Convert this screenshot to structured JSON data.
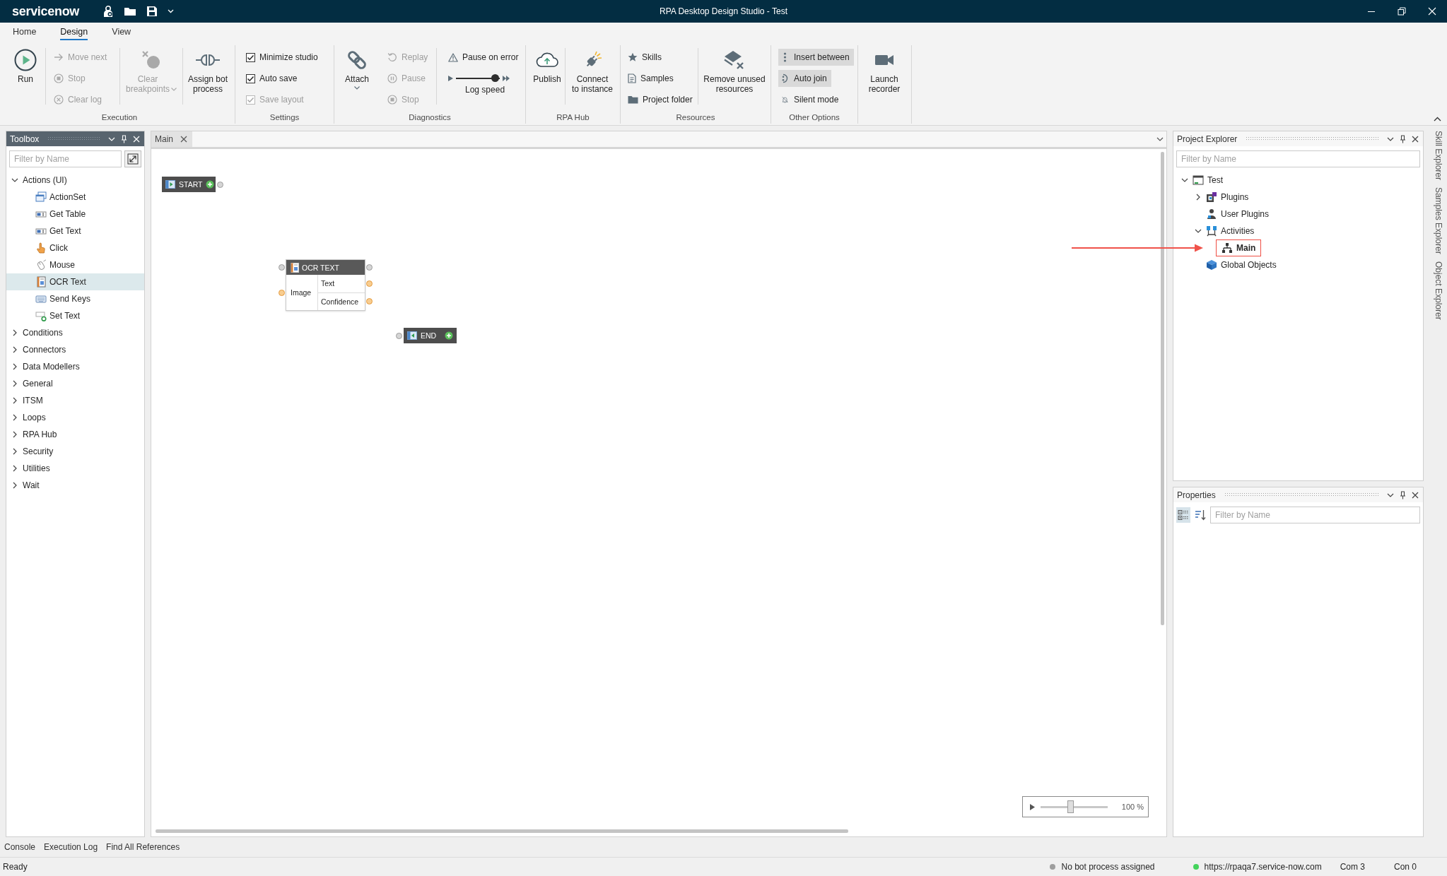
{
  "title_bar": {
    "logo": "servicenow",
    "title": "RPA Desktop Design Studio - Test"
  },
  "ribbon_tabs": [
    {
      "label": "Home",
      "selected": false
    },
    {
      "label": "Design",
      "selected": true
    },
    {
      "label": "View",
      "selected": false
    }
  ],
  "ribbon": {
    "execution": {
      "label": "Execution",
      "run": {
        "label": "Run",
        "disabled": false
      },
      "move_next": {
        "label": "Move next",
        "disabled": true
      },
      "stop": {
        "label": "Stop",
        "disabled": true
      },
      "clear_log": {
        "label": "Clear log",
        "disabled": true
      },
      "clear_breakpoints": {
        "label": "Clear\nbreakpoints",
        "disabled": true
      },
      "assign_bot_process": {
        "label": "Assign bot\nprocess",
        "disabled": false
      }
    },
    "settings": {
      "label": "Settings",
      "options": [
        {
          "label": "Minimize studio",
          "checked": true,
          "disabled": false
        },
        {
          "label": "Auto save",
          "checked": true,
          "disabled": false
        },
        {
          "label": "Save layout",
          "checked": true,
          "disabled": true
        }
      ]
    },
    "diagnostics": {
      "label": "Diagnostics",
      "attach": {
        "label": "Attach",
        "disabled": false
      },
      "replay": {
        "label": "Replay",
        "disabled": true
      },
      "pause": {
        "label": "Pause",
        "disabled": true
      },
      "stop": {
        "label": "Stop",
        "disabled": true
      },
      "pause_on_error": {
        "label": "Pause on error",
        "on": false
      },
      "log_speed": {
        "label": "Log speed",
        "level": 0.9
      }
    },
    "rpa_hub": {
      "label": "RPA Hub",
      "publish": {
        "label": "Publish"
      },
      "connect": {
        "label": "Connect\nto instance"
      }
    },
    "resources": {
      "label": "Resources",
      "skills": {
        "label": "Skills"
      },
      "samples": {
        "label": "Samples"
      },
      "project_folder": {
        "label": "Project folder"
      },
      "remove_unused": {
        "label": "Remove unused\nresources"
      }
    },
    "other_options": {
      "label": "Other Options",
      "toggles": [
        {
          "label": "Insert between",
          "on": true
        },
        {
          "label": "Auto join",
          "on": true
        },
        {
          "label": "Silent mode",
          "on": false
        }
      ]
    },
    "recorder": {
      "launch_recorder": {
        "label": "Launch\nrecorder"
      }
    }
  },
  "toolbox": {
    "title": "Toolbox",
    "active": true,
    "filter": {
      "placeholder": "Filter by Name"
    },
    "tree": [
      {
        "label": "Actions (UI)",
        "expanded": true,
        "selected": false,
        "children": [
          {
            "label": "ActionSet",
            "selected": false
          },
          {
            "label": "Get Table",
            "selected": false
          },
          {
            "label": "Get Text",
            "selected": false
          },
          {
            "label": "Click",
            "selected": false
          },
          {
            "label": "Mouse",
            "selected": false
          },
          {
            "label": "OCR Text",
            "selected": true
          },
          {
            "label": "Send Keys",
            "selected": false
          },
          {
            "label": "Set Text",
            "selected": false
          }
        ]
      },
      {
        "label": "Conditions",
        "expanded": false,
        "selected": false
      },
      {
        "label": "Connectors",
        "expanded": false,
        "selected": false
      },
      {
        "label": "Data Modellers",
        "expanded": false,
        "selected": false
      },
      {
        "label": "General",
        "expanded": false,
        "selected": false
      },
      {
        "label": "ITSM",
        "expanded": false,
        "selected": false
      },
      {
        "label": "Loops",
        "expanded": false,
        "selected": false
      },
      {
        "label": "RPA Hub",
        "expanded": false,
        "selected": false
      },
      {
        "label": "Security",
        "expanded": false,
        "selected": false
      },
      {
        "label": "Utilities",
        "expanded": false,
        "selected": false
      },
      {
        "label": "Wait",
        "expanded": false,
        "selected": false
      }
    ]
  },
  "document": {
    "tabs": [
      {
        "label": "Main",
        "selected": true
      }
    ],
    "canvas": {
      "nodes": [
        {
          "kind": "start",
          "label": "START"
        },
        {
          "kind": "activity",
          "label": "OCR TEXT",
          "inputs": [
            "Image"
          ],
          "outputs": [
            "Text",
            "Confidence"
          ]
        },
        {
          "kind": "end",
          "label": "END"
        }
      ],
      "zoom": {
        "level": 0.44,
        "reading": "100 %"
      }
    }
  },
  "project_explorer": {
    "title": "Project Explorer",
    "active": false,
    "filter": {
      "placeholder": "Filter by Name"
    },
    "tree": [
      {
        "kind": "folder",
        "label": "Test",
        "expanded": true,
        "active": false,
        "highlighted": false,
        "children": [
          {
            "kind": "folder",
            "label": "Plugins",
            "expanded": false,
            "active": false,
            "highlighted": false
          },
          {
            "kind": "item",
            "label": "User Plugins",
            "active": false,
            "highlighted": false
          },
          {
            "kind": "folder",
            "label": "Activities",
            "expanded": true,
            "active": false,
            "highlighted": false,
            "children": [
              {
                "kind": "item",
                "label": "Main",
                "active": true,
                "highlighted": true
              }
            ]
          },
          {
            "kind": "item",
            "label": "Global Objects",
            "active": false,
            "highlighted": false
          }
        ]
      }
    ]
  },
  "properties": {
    "title": "Properties",
    "active": false,
    "sort_buttons": [
      {
        "selected": true
      },
      {
        "selected": false
      }
    ],
    "filter": {
      "placeholder": "Filter by Name"
    }
  },
  "side_tabs": [
    "Skill Explorer",
    "Samples Explorer",
    "Object Explorer"
  ],
  "bottom_tabs": [
    {
      "label": "Console",
      "selected": false
    },
    {
      "label": "Execution Log",
      "selected": false
    },
    {
      "label": "Find All References",
      "selected": false
    }
  ],
  "status_bar": {
    "message": "Ready",
    "indicators": [
      {
        "label": "No bot process assigned",
        "color": "#9e9e9e"
      },
      {
        "label": "https://rpaqa7.service-now.com",
        "color": "#44d35c"
      }
    ],
    "counters": [
      "Com 3",
      "Con 0"
    ]
  }
}
